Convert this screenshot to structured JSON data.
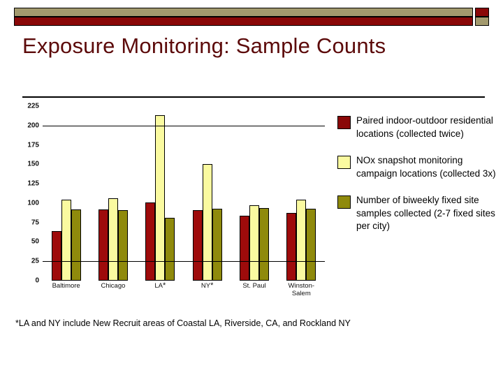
{
  "slide": {
    "title": "Exposure Monitoring: Sample Counts",
    "footnote": "*LA and NY include New Recruit areas of Coastal LA, Riverside, CA, and Rockland NY"
  },
  "decoration": {
    "bar_top_color": "#a39a6e",
    "bar_bottom_color": "#8a0808",
    "cap_top_color": "#8a0808",
    "cap_bottom_color": "#a39a6e"
  },
  "legend": {
    "position": "right",
    "entries": [
      {
        "swatch_color": "#8a0808",
        "label": "Paired indoor-outdoor residential locations (collected twice)"
      },
      {
        "swatch_color": "#fafaa0",
        "label": "NOx snapshot monitoring campaign locations (collected 3x)"
      },
      {
        "swatch_color": "#8f8a0c",
        "label": "Number of biweekly fixed site samples collected (2-7 fixed sites per city)"
      }
    ]
  },
  "chart_data": {
    "type": "bar",
    "title": "Exposure Monitoring: Sample Counts",
    "xlabel": "",
    "ylabel": "",
    "ylim": [
      0,
      225
    ],
    "yticks": [
      0,
      25,
      50,
      75,
      100,
      125,
      150,
      175,
      200,
      225
    ],
    "ytick_labels": [
      "0",
      "25",
      "50",
      "75",
      "100",
      "125",
      "150",
      "175",
      "200",
      "225"
    ],
    "grid": "horizontal gridlines at 25 and 200 only",
    "gridlines": [
      25,
      200
    ],
    "categories": [
      "Baltimore",
      "Chicago",
      "LA*",
      "NY *",
      "St. Paul",
      "Winston-Salem"
    ],
    "category_labels": [
      {
        "text": "Baltimore",
        "star": false
      },
      {
        "text": "Chicago",
        "star": false
      },
      {
        "text": "LA",
        "star": true
      },
      {
        "text": "NY",
        "star": true
      },
      {
        "text": "St. Paul",
        "star": false
      },
      {
        "text": "Winston-Salem",
        "star": false
      }
    ],
    "series": [
      {
        "name": "Paired indoor-outdoor residential locations (collected twice)",
        "color": "#9e0b0b",
        "values": [
          64,
          92,
          101,
          91,
          84,
          87
        ]
      },
      {
        "name": "NOx snapshot monitoring campaign locations (collected 3x)",
        "color": "#fafaa0",
        "values": [
          104,
          106,
          213,
          150,
          97,
          104
        ]
      },
      {
        "name": "Number of biweekly fixed site samples collected (2-7 fixed sites per city)",
        "color": "#8f8a0c",
        "values": [
          92,
          91,
          81,
          93,
          94,
          93
        ]
      }
    ]
  }
}
